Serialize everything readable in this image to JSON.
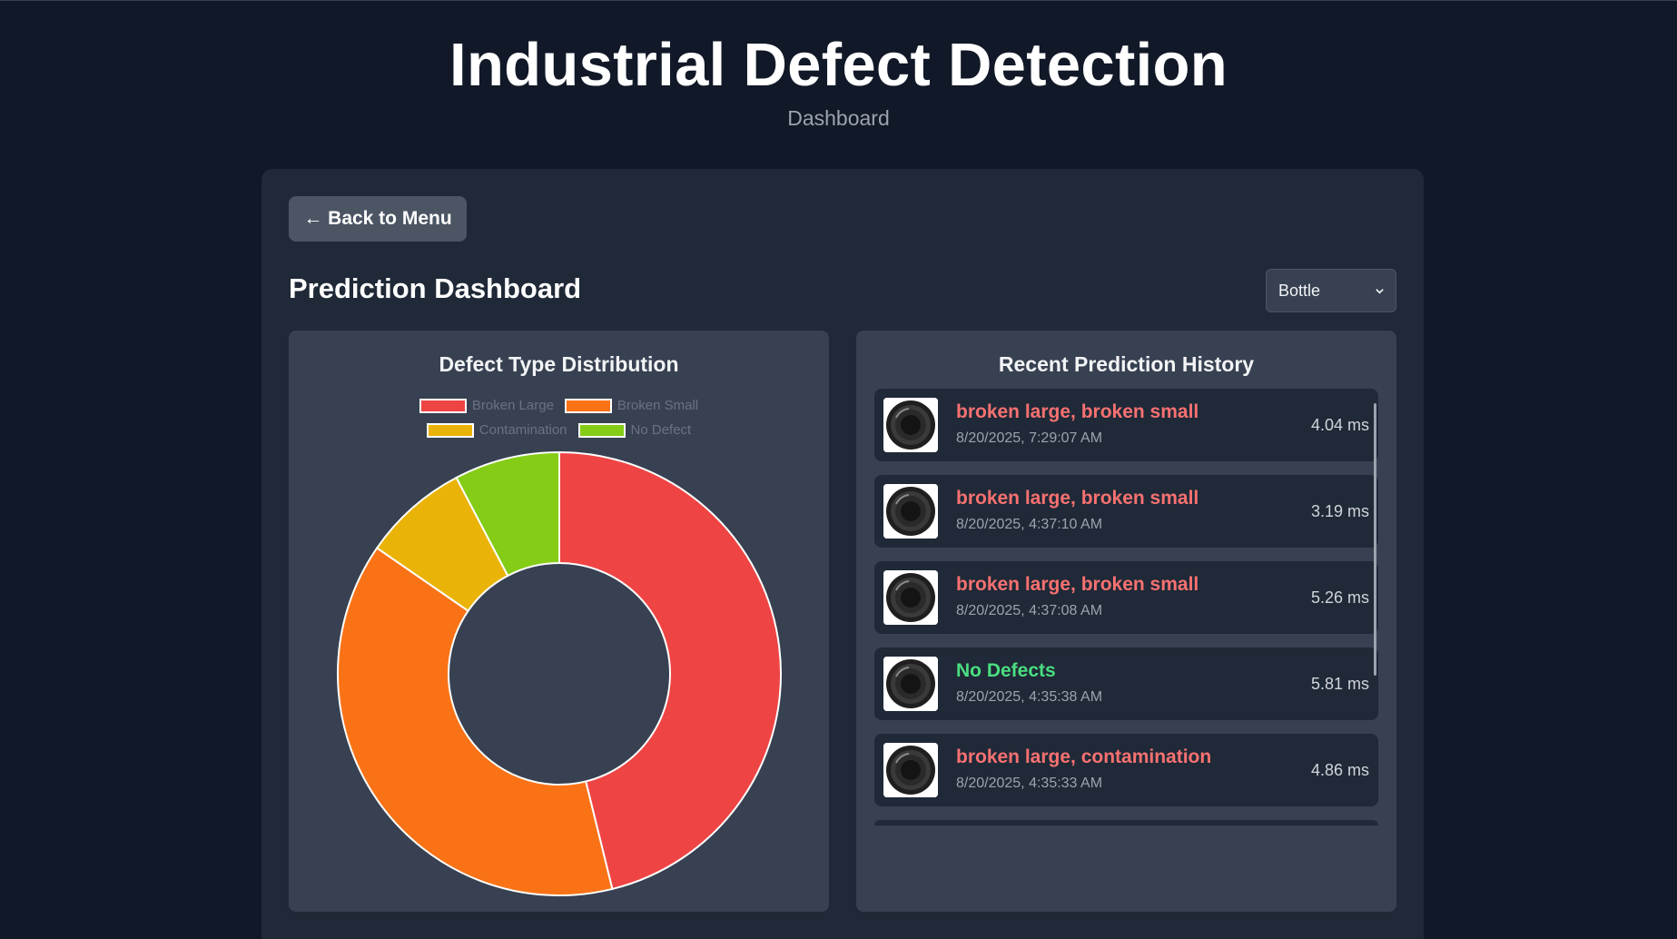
{
  "header": {
    "title": "Industrial Defect Detection",
    "subtitle": "Dashboard"
  },
  "toolbar": {
    "back_label": "← Back to Menu"
  },
  "dashboard": {
    "title": "Prediction Dashboard",
    "product_select": {
      "value": "Bottle",
      "icon": "chevron-down-icon"
    }
  },
  "chart_panel": {
    "title": "Defect Type Distribution"
  },
  "chart_data": {
    "type": "pie",
    "title": "Defect Type Distribution",
    "categories": [
      "Broken Large",
      "Broken Small",
      "Contamination",
      "No Defect"
    ],
    "values": [
      6,
      5,
      1,
      1
    ],
    "colors": [
      "#ef4444",
      "#f97316",
      "#eab308",
      "#84cc16"
    ],
    "legend_position": "top",
    "donut": true
  },
  "history_panel": {
    "title": "Recent Prediction History",
    "items": [
      {
        "label": "broken large, broken small",
        "timestamp": "8/20/2025, 7:29:07 AM",
        "duration": "4.04 ms",
        "status": "defect"
      },
      {
        "label": "broken large, broken small",
        "timestamp": "8/20/2025, 4:37:10 AM",
        "duration": "3.19 ms",
        "status": "defect"
      },
      {
        "label": "broken large, broken small",
        "timestamp": "8/20/2025, 4:37:08 AM",
        "duration": "5.26 ms",
        "status": "defect"
      },
      {
        "label": "No Defects",
        "timestamp": "8/20/2025, 4:35:38 AM",
        "duration": "5.81 ms",
        "status": "ok"
      },
      {
        "label": "broken large, contamination",
        "timestamp": "8/20/2025, 4:35:33 AM",
        "duration": "4.86 ms",
        "status": "defect"
      }
    ]
  }
}
